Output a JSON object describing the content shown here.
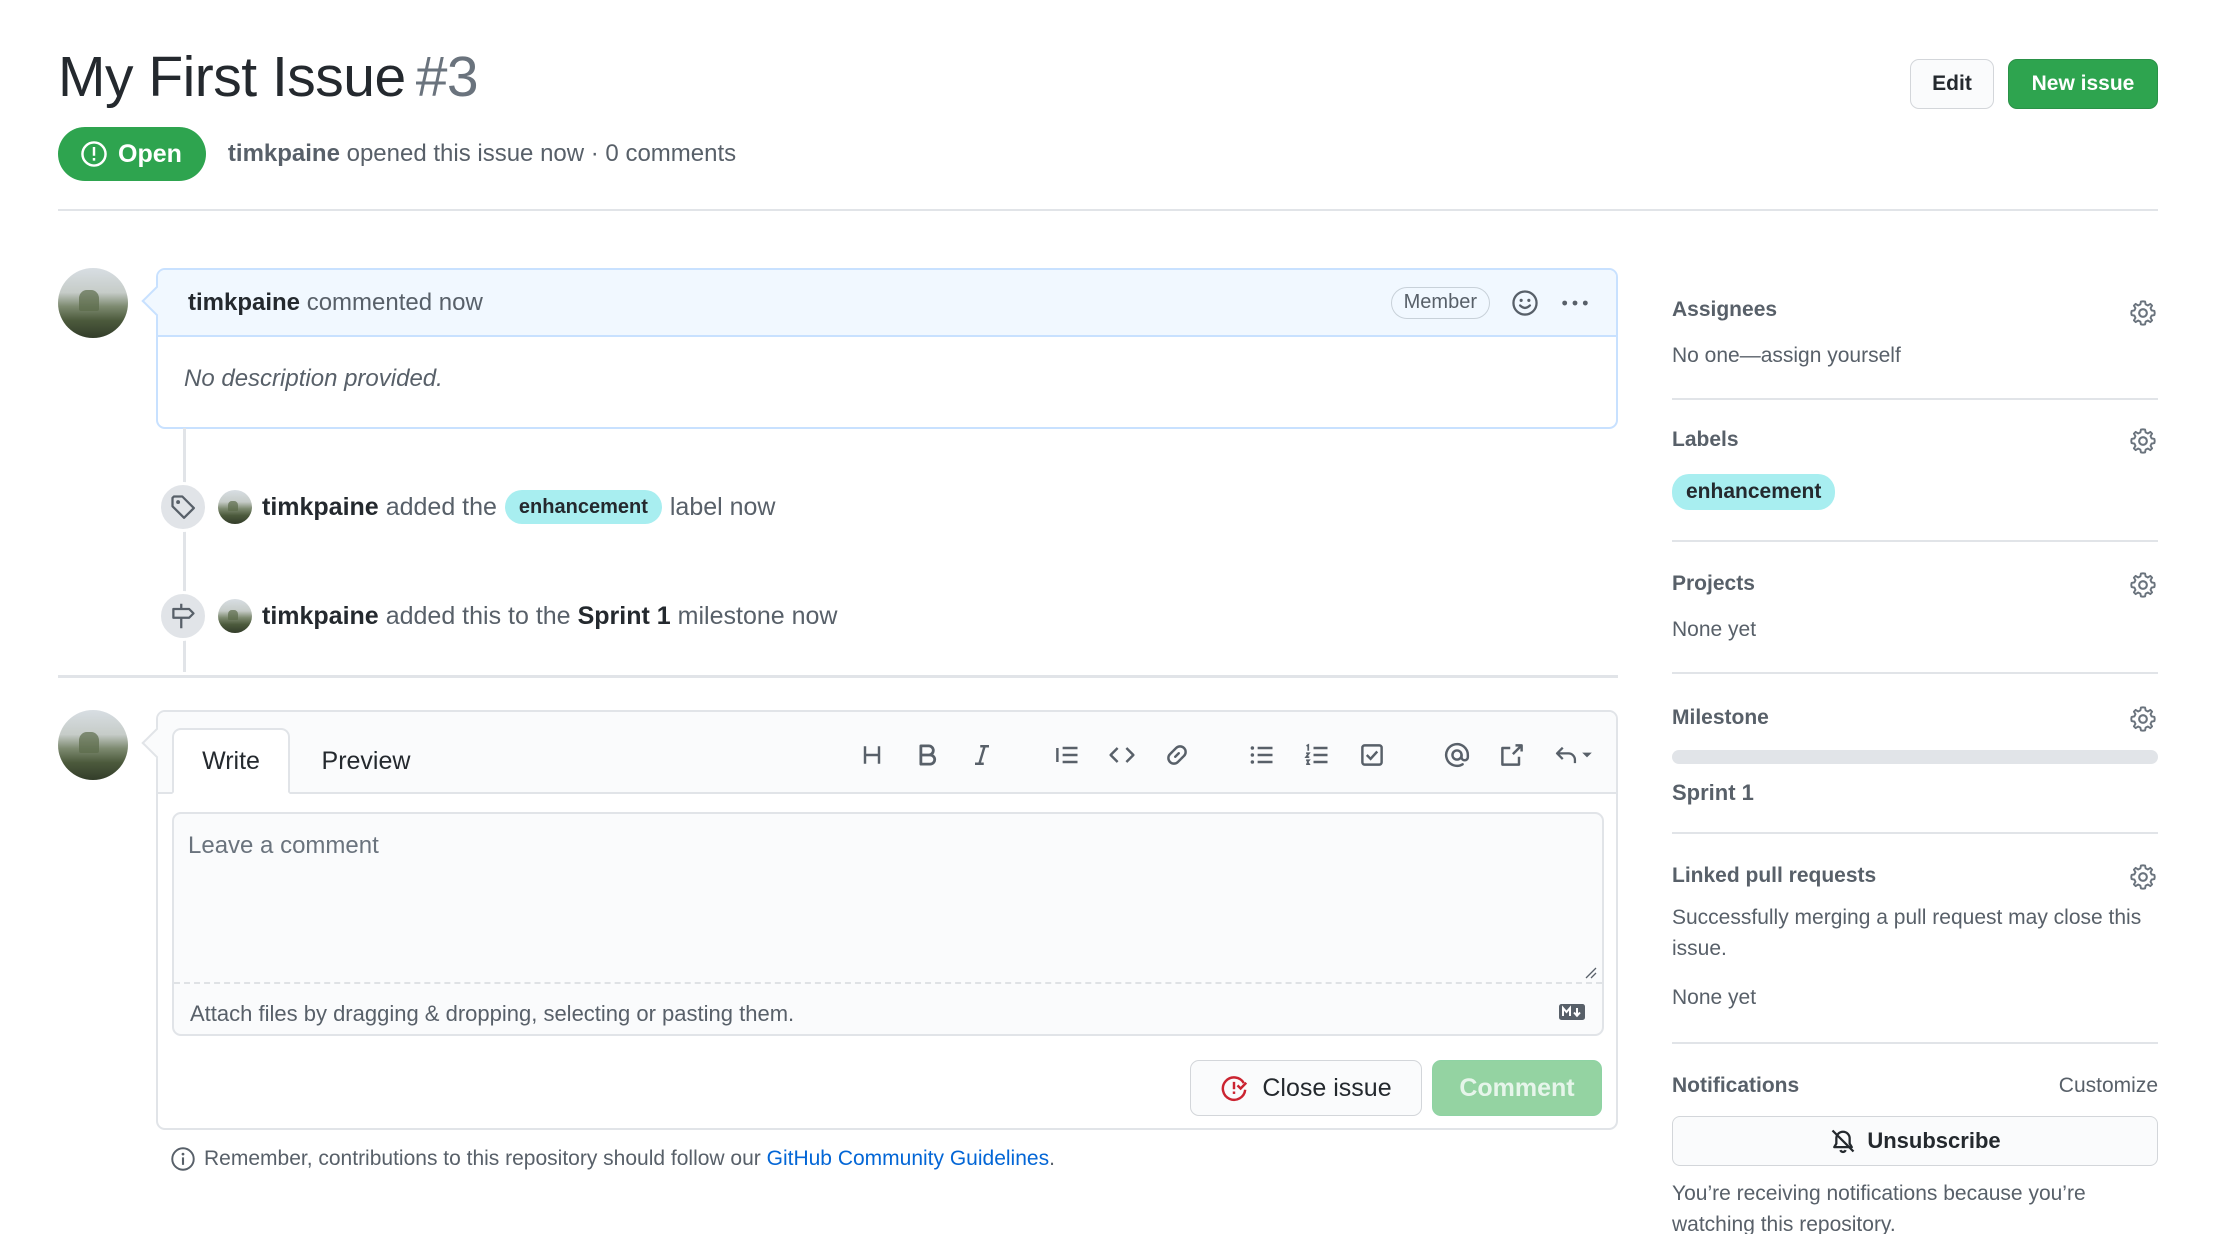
{
  "header": {
    "title": "My First Issue",
    "number": "#3",
    "edit_label": "Edit",
    "new_issue_label": "New issue",
    "state": "Open",
    "author": "timkpaine",
    "meta": "opened this issue now · 0 comments"
  },
  "comment": {
    "author": "timkpaine",
    "action": "commented now",
    "badge": "Member",
    "body": "No description provided."
  },
  "events": [
    {
      "author": "timkpaine",
      "prefix": "added the",
      "label": "enhancement",
      "suffix": "label now"
    },
    {
      "author": "timkpaine",
      "prefix": "added this to the",
      "milestone": "Sprint 1",
      "suffix": "milestone now"
    }
  ],
  "form": {
    "tabs": [
      "Write",
      "Preview"
    ],
    "placeholder": "Leave a comment",
    "attach_text": "Attach files by dragging & dropping, selecting or pasting them.",
    "close_label": "Close issue",
    "comment_label": "Comment"
  },
  "guidelines": {
    "text": "Remember, contributions to this repository should follow our",
    "link": "GitHub Community Guidelines",
    "end": "."
  },
  "sidebar": {
    "assignees": {
      "heading": "Assignees",
      "value": "No one—assign yourself"
    },
    "labels": {
      "heading": "Labels",
      "value": "enhancement",
      "color": "#a8eef0"
    },
    "projects": {
      "heading": "Projects",
      "value": "None yet"
    },
    "milestone": {
      "heading": "Milestone",
      "value": "Sprint 1",
      "progress": 0
    },
    "linked_prs": {
      "heading": "Linked pull requests",
      "description": "Successfully merging a pull request may close this issue.",
      "value": "None yet"
    },
    "notifications": {
      "heading": "Notifications",
      "customize": "Customize",
      "button": "Unsubscribe",
      "reason": "You’re receiving notifications because you’re watching this repository."
    }
  },
  "colors": {
    "green": "#2ea44f",
    "label_bg": "#a8eef0",
    "link": "#0366d6",
    "close_icon": "#cb2431"
  }
}
